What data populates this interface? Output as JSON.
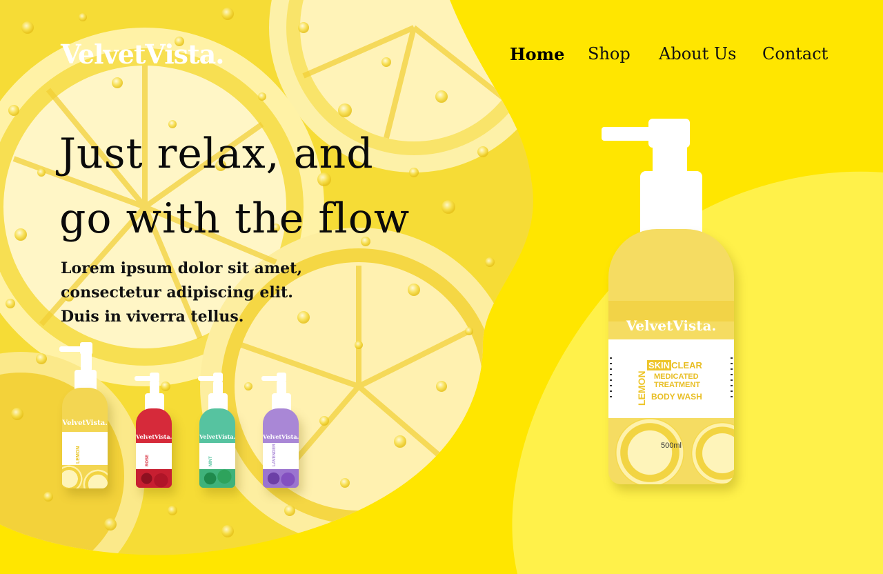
{
  "brand": {
    "logo": "VelvetVista."
  },
  "nav": {
    "items": [
      {
        "label": "Home",
        "active": true
      },
      {
        "label": "Shop",
        "active": false
      },
      {
        "label": "About Us",
        "active": false
      },
      {
        "label": "Contact",
        "active": false
      }
    ]
  },
  "hero": {
    "headline_line1": "Just relax, and",
    "headline_line2": "go with the flow",
    "description": "Lorem ipsum dolor sit amet, consectetur adipiscing elit. Duis in viverra tellus."
  },
  "featured_product": {
    "brand": "VelvetVista.",
    "variant": "LEMON",
    "line_skin": "SKIN",
    "line_clear": "CLEAR",
    "line2": "MEDICATED",
    "line3": "TREATMENT",
    "line4": "BODY WASH",
    "volume": "500ml"
  },
  "variants": [
    {
      "brand": "VelvetVista.",
      "variant": "LEMON",
      "color": "#f3d652"
    },
    {
      "brand": "VelvetVista.",
      "variant": "ROSE",
      "color": "#d62a3a"
    },
    {
      "brand": "VelvetVista.",
      "variant": "MINT",
      "color": "#56c3a0"
    },
    {
      "brand": "VelvetVista.",
      "variant": "LAVENDER",
      "color": "#a987d6"
    }
  ],
  "colors": {
    "background": "#ffe600",
    "accent_blob": "#fff04a",
    "text": "#0a0a0a"
  }
}
